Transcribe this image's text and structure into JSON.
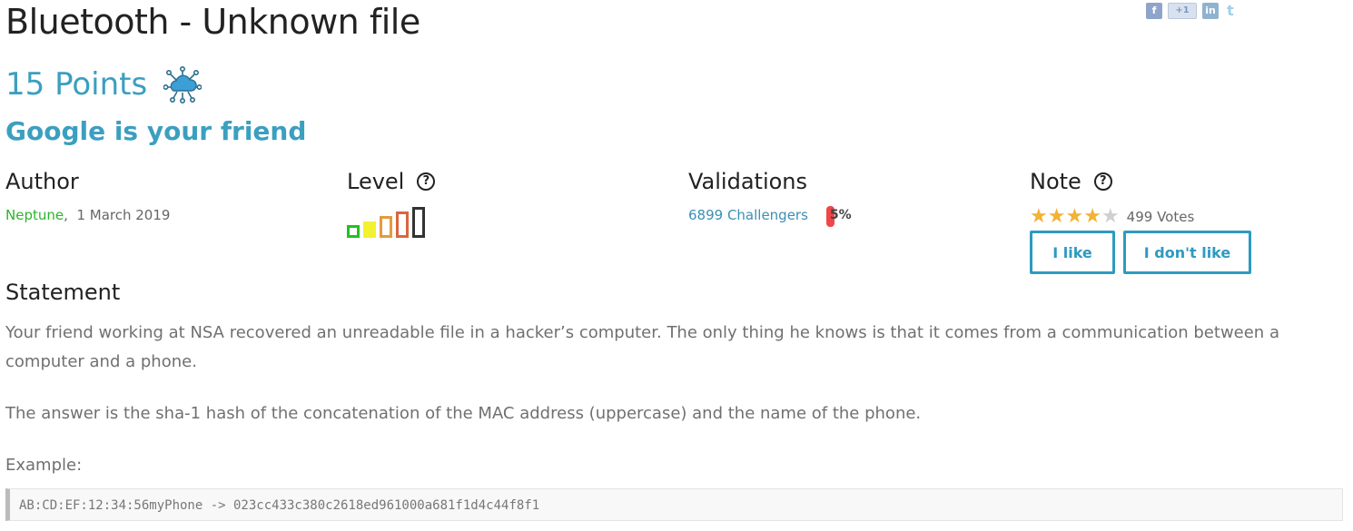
{
  "challenge": {
    "title": "Bluetooth - Unknown file",
    "points": "15 Points",
    "category_icon": "network-cloud-icon",
    "subtitle": "Google is your friend"
  },
  "share": {
    "facebook": "f",
    "googleplus": "+1",
    "linkedin": "in",
    "twitter": "t"
  },
  "author": {
    "heading": "Author",
    "name": "Neptune",
    "separator": ",",
    "date": "1 March 2019"
  },
  "level": {
    "heading": "Level",
    "help": "?",
    "current_level": 5,
    "max_level": 5,
    "colors": [
      "#22c122",
      "#f2f230",
      "#e69a3d",
      "#d9663f",
      "#333333"
    ]
  },
  "validations": {
    "heading": "Validations",
    "challengers": "6899 Challengers",
    "percent": "5%"
  },
  "note": {
    "heading": "Note",
    "help": "?",
    "rating": 4,
    "max_rating": 5,
    "votes": "499 Votes",
    "like_label": "I like",
    "dislike_label": "I don't like"
  },
  "statement": {
    "heading": "Statement",
    "paragraph1": "Your friend working at NSA recovered an unreadable file in a hacker’s computer. The only thing he knows is that it comes from a communication between a computer and a phone.",
    "paragraph2": "The answer is the sha-1 hash of the concatenation of the MAC address (uppercase) and the name of the phone.",
    "example_label": "Example:",
    "example_code": "AB:CD:EF:12:34:56myPhone -> 023cc433c380c2618ed961000a681f1d4c44f8f1"
  },
  "colors": {
    "accent": "#3b9fc0",
    "author_link": "#2bb52b",
    "button_border": "#2e9ac0",
    "validation_bar": "#f0464a",
    "star_on": "#f2b233",
    "star_off": "#cfcfcf"
  }
}
